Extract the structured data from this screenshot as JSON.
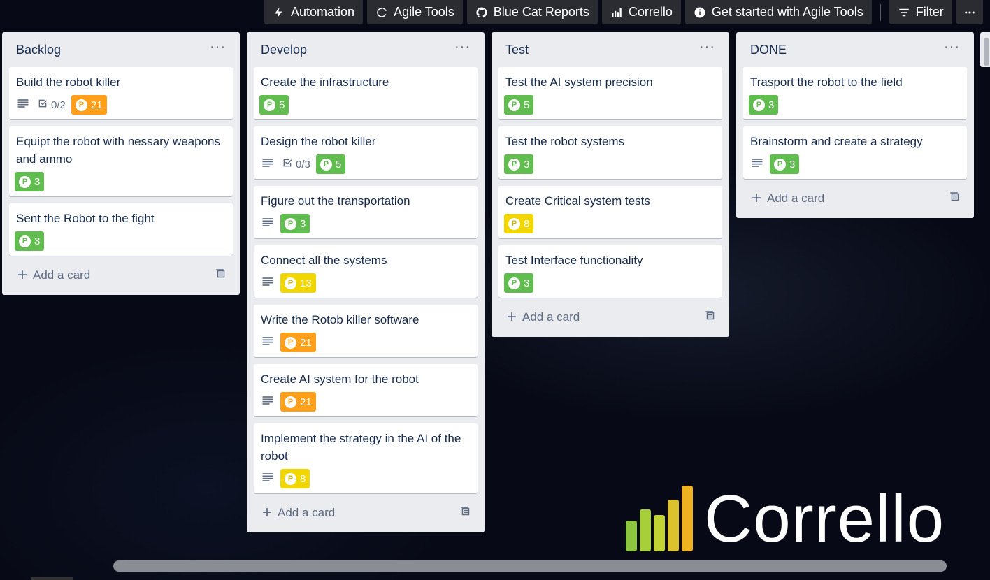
{
  "toolbar": {
    "automation": "Automation",
    "agile_tools": "Agile Tools",
    "blue_cat": "Blue Cat Reports",
    "corrello": "Corrello",
    "get_started": "Get started with Agile Tools",
    "filter": "Filter"
  },
  "lists": [
    {
      "title": "Backlog",
      "cards": [
        {
          "title": "Build the robot killer",
          "desc": true,
          "checklist": "0/2",
          "points": "21",
          "color": "#ff9f1a"
        },
        {
          "title": "Equipt the robot with nessary weapons and ammo",
          "desc": false,
          "checklist": null,
          "points": "3",
          "color": "#61bd4f"
        },
        {
          "title": "Sent the Robot to the fight",
          "desc": false,
          "checklist": null,
          "points": "3",
          "color": "#61bd4f"
        }
      ],
      "add_label": "Add a card"
    },
    {
      "title": "Develop",
      "cards": [
        {
          "title": "Create the infrastructure",
          "desc": false,
          "checklist": null,
          "points": "5",
          "color": "#61bd4f"
        },
        {
          "title": "Design the robot killer",
          "desc": true,
          "checklist": "0/3",
          "points": "5",
          "color": "#61bd4f"
        },
        {
          "title": "Figure out the transportation",
          "desc": true,
          "checklist": null,
          "points": "3",
          "color": "#61bd4f"
        },
        {
          "title": "Connect all the systems",
          "desc": true,
          "checklist": null,
          "points": "13",
          "color": "#f2d600"
        },
        {
          "title": "Write the Rotob killer software",
          "desc": true,
          "checklist": null,
          "points": "21",
          "color": "#ff9f1a"
        },
        {
          "title": "Create AI system for the robot",
          "desc": true,
          "checklist": null,
          "points": "21",
          "color": "#ff9f1a"
        },
        {
          "title": "Implement the strategy in the AI of the robot",
          "desc": true,
          "checklist": null,
          "points": "8",
          "color": "#f2d600"
        }
      ],
      "add_label": "Add a card"
    },
    {
      "title": "Test",
      "cards": [
        {
          "title": "Test the AI system precision",
          "desc": false,
          "checklist": null,
          "points": "5",
          "color": "#61bd4f"
        },
        {
          "title": "Test the robot systems",
          "desc": false,
          "checklist": null,
          "points": "3",
          "color": "#61bd4f"
        },
        {
          "title": "Create Critical system tests",
          "desc": false,
          "checklist": null,
          "points": "8",
          "color": "#f2d600"
        },
        {
          "title": "Test Interface functionality",
          "desc": false,
          "checklist": null,
          "points": "3",
          "color": "#61bd4f"
        }
      ],
      "add_label": "Add a card"
    },
    {
      "title": "DONE",
      "cards": [
        {
          "title": "Trasport the robot to the field",
          "desc": false,
          "checklist": null,
          "points": "3",
          "color": "#61bd4f"
        },
        {
          "title": "Brainstorm and create a strategy",
          "desc": true,
          "checklist": null,
          "points": "3",
          "color": "#61bd4f"
        }
      ],
      "add_label": "Add a card"
    }
  ],
  "logo": {
    "text": "Corrello",
    "bar_colors": [
      "#8cc63f",
      "#a6cf3a",
      "#c2d433",
      "#dcc22c",
      "#f0b21e"
    ]
  }
}
